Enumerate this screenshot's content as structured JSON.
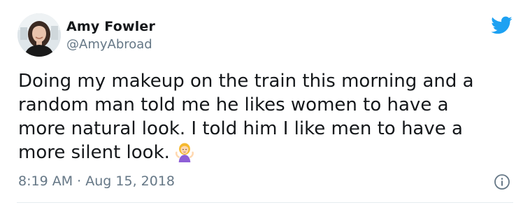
{
  "tweet": {
    "author": {
      "name": "Amy Fowler",
      "handle": "@AmyAbroad"
    },
    "text_lines": [
      "Doing my makeup on the train this morning and a",
      "random man told me he likes women to have a",
      "more natural look. I told him I like men to have a",
      "more silent look."
    ],
    "emoji": "person-shrugging-emoji",
    "time": "8:19 AM",
    "separator": "·",
    "date": "Aug 15, 2018"
  },
  "icons": {
    "brand": "twitter-bird-icon",
    "info": "info-icon"
  },
  "colors": {
    "twitter_blue": "#1da1f2",
    "text_primary": "#14171a",
    "text_secondary": "#657786",
    "border": "#e6ecf0"
  }
}
